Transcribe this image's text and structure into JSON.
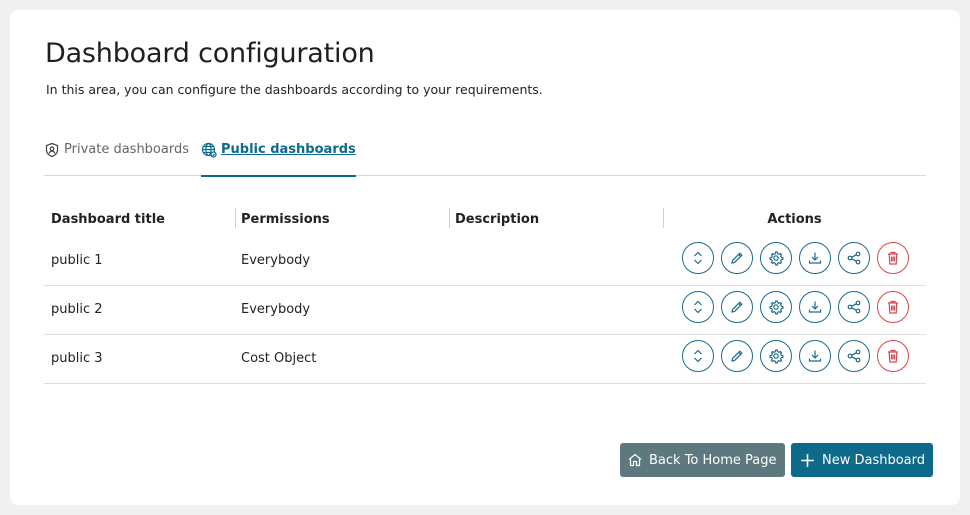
{
  "page": {
    "title": "Dashboard configuration",
    "subtitle": "In this area, you can configure the dashboards according to your requirements."
  },
  "tabs": [
    {
      "label": "Private dashboards",
      "icon": "shield-user-icon",
      "active": false
    },
    {
      "label": "Public dashboards",
      "icon": "globe-icon",
      "active": true
    }
  ],
  "table": {
    "columns": [
      "Dashboard title",
      "Permissions",
      "Description",
      "Actions"
    ],
    "rows": [
      {
        "title": "public 1",
        "permissions": "Everybody",
        "description": ""
      },
      {
        "title": "public 2",
        "permissions": "Everybody",
        "description": ""
      },
      {
        "title": "public 3",
        "permissions": "Cost Object",
        "description": ""
      }
    ],
    "actions": [
      "reorder-icon",
      "edit-icon",
      "settings-icon",
      "download-icon",
      "share-icon",
      "delete-icon"
    ]
  },
  "buttons": {
    "home": "Back To Home Page",
    "new": "New Dashboard"
  },
  "colors": {
    "accent": "#0d6a8b",
    "danger": "#d9484e",
    "secondary": "#5e7880"
  }
}
